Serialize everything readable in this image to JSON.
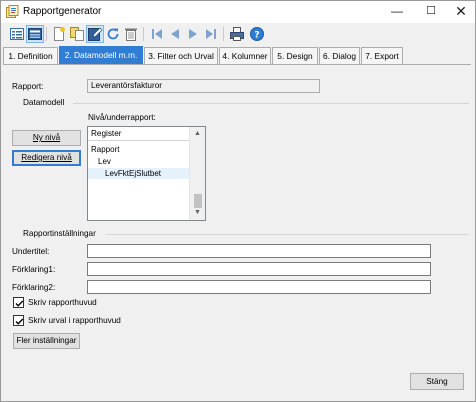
{
  "window": {
    "title": "Rapportgenerator",
    "minimize": "—",
    "maximize": "☐",
    "close": "✕"
  },
  "tabs": [
    {
      "label": "1. Definition",
      "active": false
    },
    {
      "label": "2. Datamodell m.m.",
      "active": true
    },
    {
      "label": "3. Filter och Urval",
      "active": false
    },
    {
      "label": "4. Kolumner",
      "active": false
    },
    {
      "label": "5. Design",
      "active": false
    },
    {
      "label": "6. Dialog",
      "active": false
    },
    {
      "label": "7. Export",
      "active": false
    }
  ],
  "report": {
    "label": "Rapport:",
    "value": "Leverantörsfakturor"
  },
  "datamodel": {
    "group_label": "Datamodell",
    "level_label": "Nivå/underrapport:",
    "new_level_button": "Ny nivå",
    "edit_level_button": "Redigera nivå",
    "list_header": "Register",
    "items": [
      {
        "label": "Rapport",
        "selected": false
      },
      {
        "label": "Lev",
        "selected": false
      },
      {
        "label": "LevFktEjSlutbet",
        "selected": true
      }
    ],
    "scroll_up": "▲",
    "scroll_down": "▼"
  },
  "settings": {
    "group_label": "Rapportinställningar",
    "subtitle_label": "Undertitel:",
    "subtitle_value": "",
    "explanation1_label": "Förklaring1:",
    "explanation1_value": "",
    "explanation2_label": "Förklaring2:",
    "explanation2_value": "",
    "print_header_label": "Skriv rapporthuvud",
    "print_header_checked": true,
    "print_selection_label": "Skriv urval i rapporthuvud",
    "print_selection_checked": true,
    "more_settings_button": "Fler inställningar"
  },
  "close_button": "Stäng",
  "colors": {
    "accent": "#2f7ed3",
    "window_bg": "#f0f0f0",
    "selection": "#e5f1fb"
  }
}
